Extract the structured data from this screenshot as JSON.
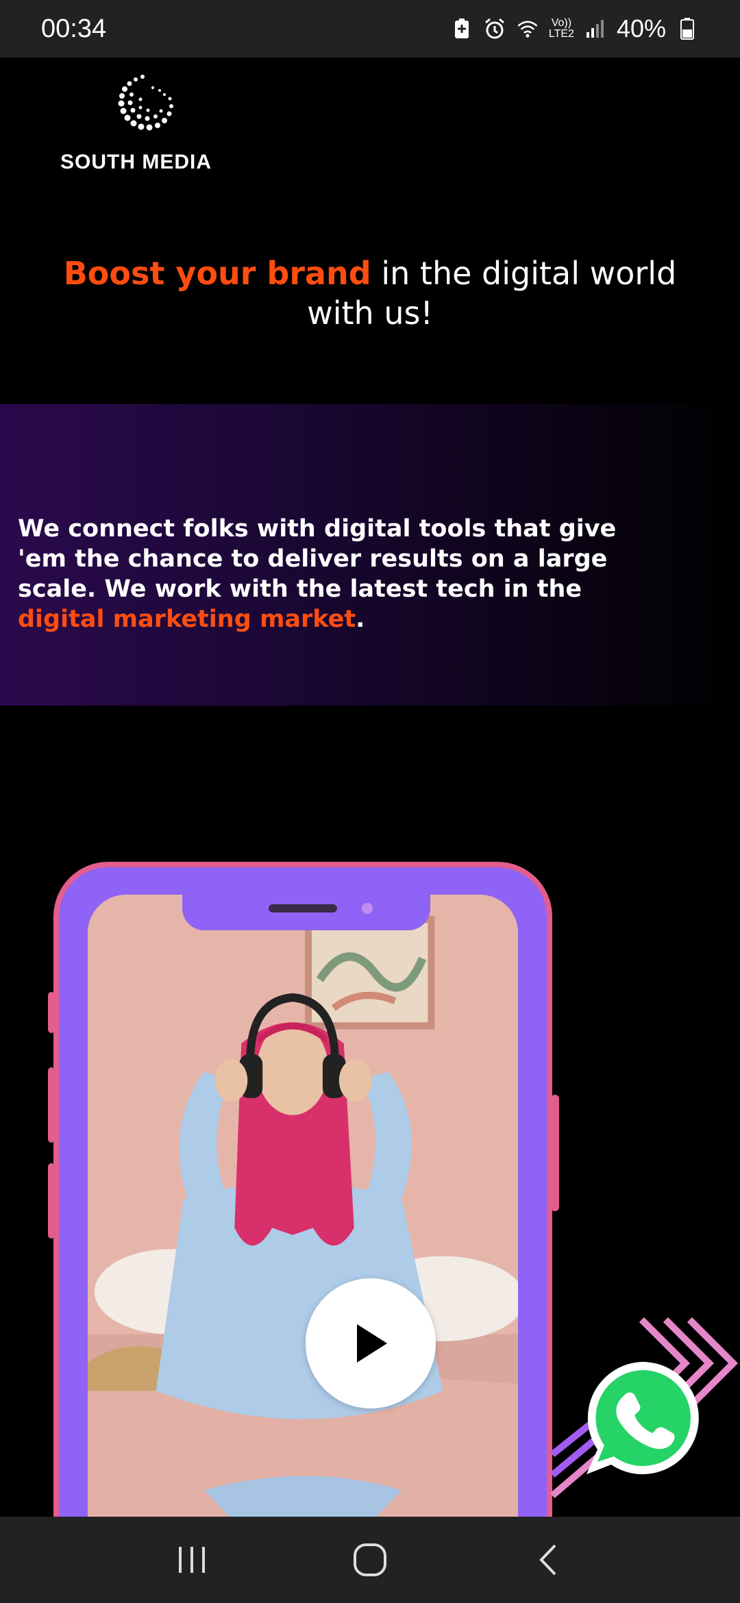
{
  "status_bar": {
    "time": "00:34",
    "network_label_top": "Vo))",
    "network_label_bottom": "LTE2",
    "battery": "40%"
  },
  "logo": {
    "text": "SOUTH MEDIA"
  },
  "headline": {
    "accent": "Boost your brand",
    "rest_line1": " in the digital world",
    "rest_line2": "with us!"
  },
  "intro": {
    "text": "We connect folks with digital tools that give 'em the chance to deliver results on a large scale. We work with the latest tech in the ",
    "accent": "digital marketing market",
    "end": "."
  },
  "colors": {
    "accent": "#ff4d0f",
    "phone_frame": "#e35d8f",
    "phone_body": "#8f63f5",
    "whatsapp": "#25d366"
  },
  "icons": {
    "play": "play-icon",
    "whatsapp": "whatsapp-icon",
    "nav_recent": "recent-apps-icon",
    "nav_home": "home-icon",
    "nav_back": "back-icon"
  }
}
